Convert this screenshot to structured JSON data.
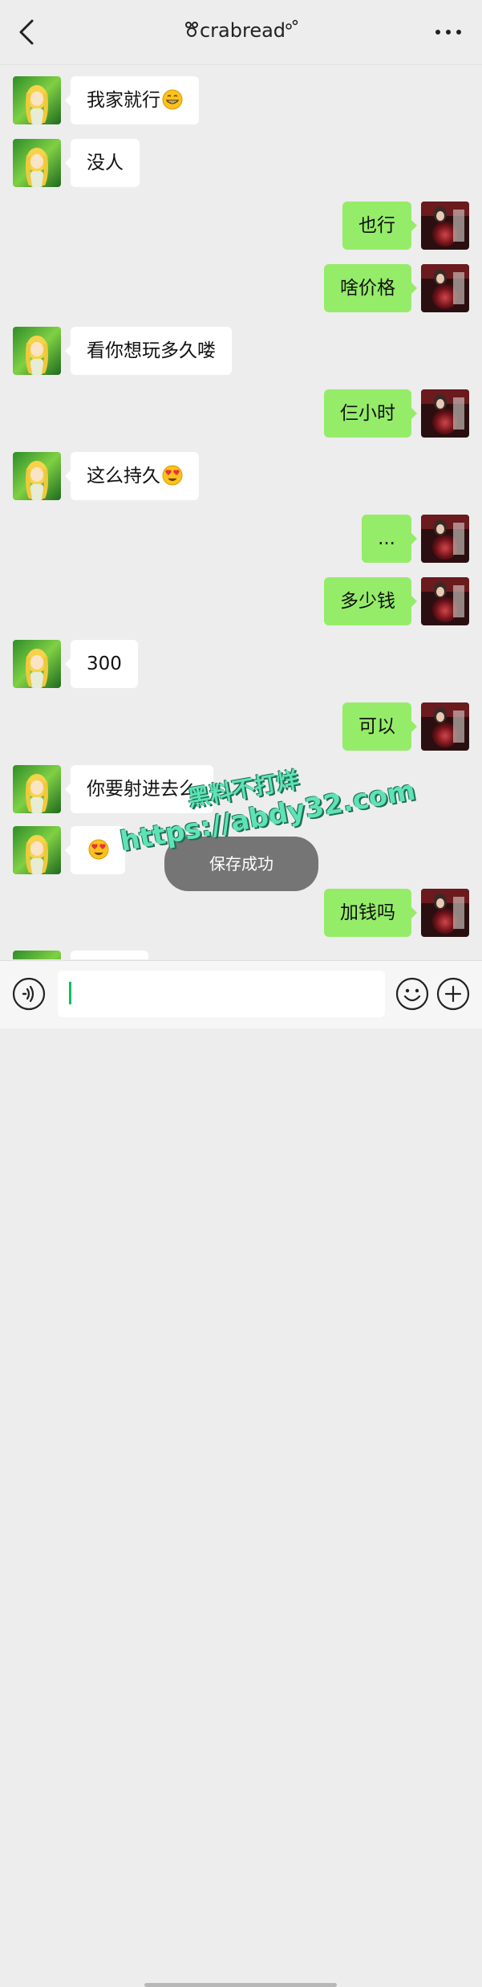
{
  "header": {
    "title": "crabread",
    "back_icon": "chevron-left-icon",
    "more_icon": "more-dots-icon"
  },
  "messages": [
    {
      "side": "left",
      "text": "我家就行",
      "emoji": "grinning-face-emoji"
    },
    {
      "side": "left",
      "text": "没人"
    },
    {
      "side": "right",
      "text": "也行"
    },
    {
      "side": "right",
      "text": "啥价格"
    },
    {
      "side": "left",
      "text": "看你想玩多久喽"
    },
    {
      "side": "right",
      "text": "仨小时"
    },
    {
      "side": "left",
      "text": "这么持久",
      "emoji": "heart-eyes-emoji"
    },
    {
      "side": "right",
      "text": "..."
    },
    {
      "side": "right",
      "text": "多少钱"
    },
    {
      "side": "left",
      "text": "300"
    },
    {
      "side": "right",
      "text": "可以"
    },
    {
      "side": "left",
      "text": "你要射进去么"
    },
    {
      "side": "left",
      "text": "",
      "emoji": "heart-eyes-emoji"
    },
    {
      "side": "right",
      "text": "加钱吗"
    },
    {
      "side": "left",
      "text": ""
    }
  ],
  "toast": {
    "text": "保存成功"
  },
  "watermark": {
    "line1": "黑料不打烊",
    "line2": "https://abdy32.com"
  },
  "input_bar": {
    "voice_icon": "voice-icon",
    "input_value": "",
    "emoji_icon": "emoji-smile-icon",
    "plus_icon": "plus-icon"
  },
  "colors": {
    "background": "#ededed",
    "sent_bubble": "#95ec69",
    "received_bubble": "#ffffff",
    "accent": "#07c160"
  }
}
